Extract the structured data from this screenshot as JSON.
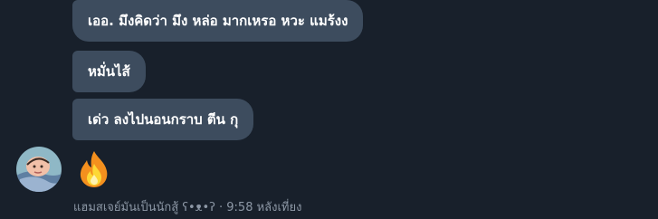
{
  "messages": [
    {
      "text": "เออ. มึงคิดว่า มึง หล่อ มากเหรอ หวะ แมร้งง"
    },
    {
      "text": "หมั่นไส้"
    },
    {
      "text": "เด่ว ลงไปนอนกราบ ตีน กุ"
    }
  ],
  "reaction_emoji": "fire-emoji",
  "sender": {
    "name": "แฮมสเจย์มันเป็นนักสู้ ʕ•ᴥ•ʔ",
    "separator": " · ",
    "time": "9:58 หลังเที่ยง"
  },
  "colors": {
    "background": "#18202b",
    "bubble": "#3d4c5e",
    "meta_text": "#8d98a6"
  }
}
